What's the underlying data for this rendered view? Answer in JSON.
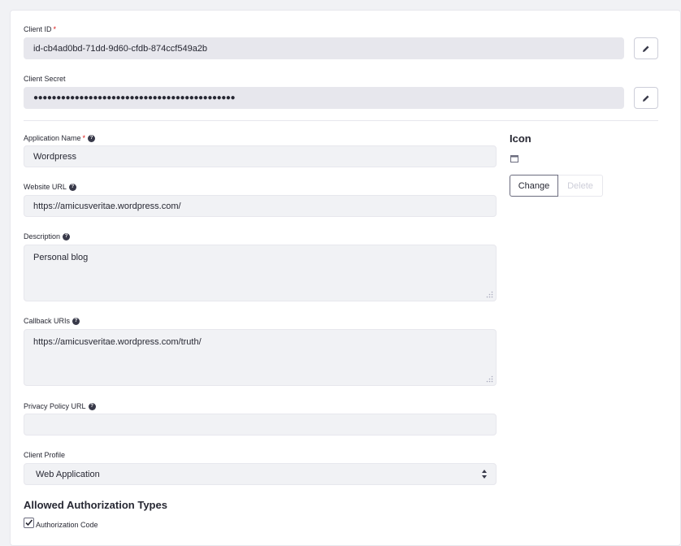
{
  "client_id": {
    "label": "Client ID",
    "required_mark": "*",
    "value": "id-cb4ad0bd-71dd-9d60-cfdb-874ccf549a2b",
    "edit_icon": "pencil-icon"
  },
  "client_secret": {
    "label": "Client Secret",
    "value": "●●●●●●●●●●●●●●●●●●●●●●●●●●●●●●●●●●●●●●●●●●●●",
    "edit_icon": "pencil-icon"
  },
  "app_name": {
    "label": "Application Name",
    "required_mark": "*",
    "value": "Wordpress",
    "help_icon": "question-icon"
  },
  "website_url": {
    "label": "Website URL",
    "value": "https://amicusveritae.wordpress.com/"
  },
  "description": {
    "label": "Description",
    "value": "Personal blog"
  },
  "callback_uris": {
    "label": "Callback URIs",
    "value": "https://amicusveritae.wordpress.com/truth/"
  },
  "privacy_policy_url": {
    "label": "Privacy Policy URL",
    "value": ""
  },
  "client_profile": {
    "label": "Client Profile",
    "selected": "Web Application"
  },
  "icon_panel": {
    "title": "Icon",
    "change_label": "Change",
    "delete_label": "Delete",
    "image_icon": "image-placeholder-icon"
  },
  "authorization_types": {
    "title": "Allowed Authorization Types",
    "items": [
      {
        "label": "Authorization Code",
        "checked": true
      }
    ]
  }
}
